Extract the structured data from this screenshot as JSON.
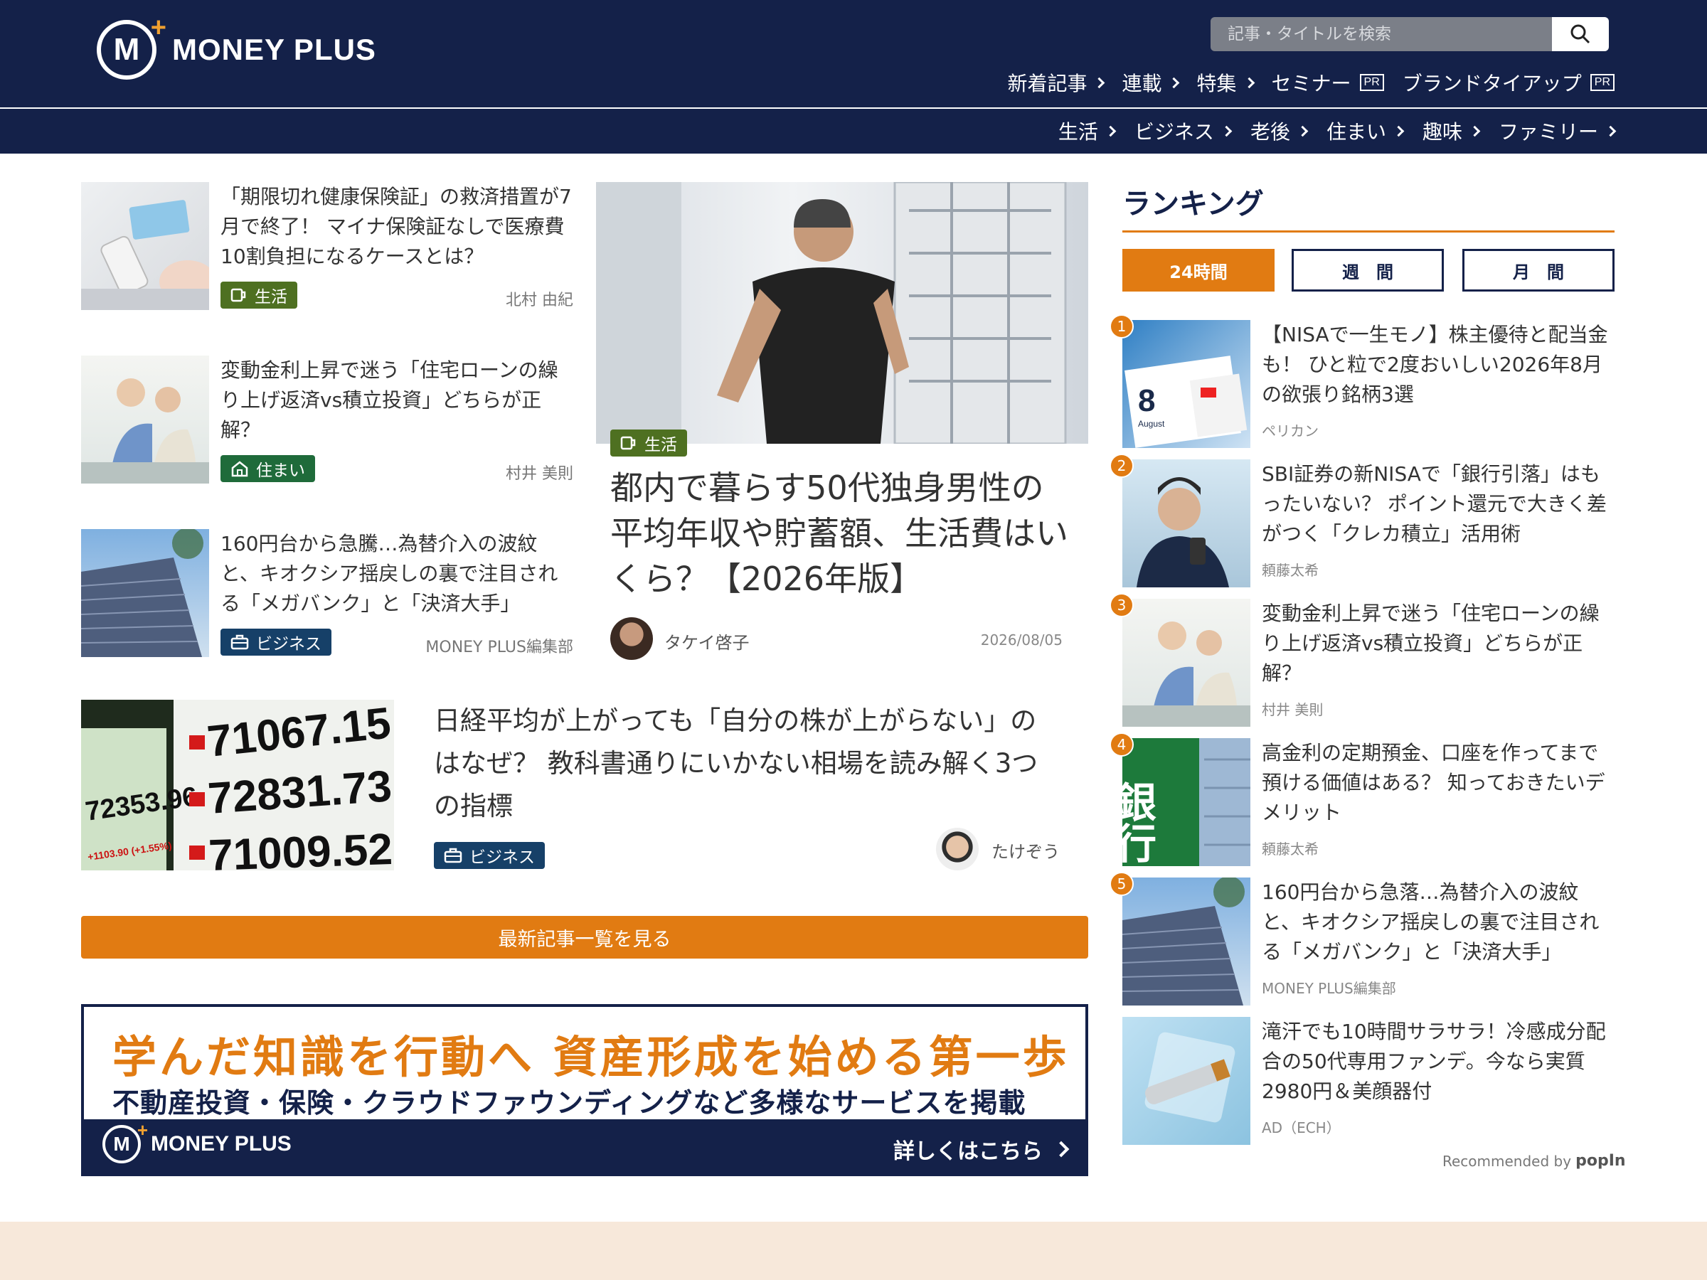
{
  "header": {
    "logo_text": "MONEY PLUS",
    "search_placeholder": "記事・タイトルを検索",
    "nav_main": [
      {
        "label": "新着記事",
        "pr": false
      },
      {
        "label": "連載",
        "pr": false
      },
      {
        "label": "特集",
        "pr": false
      },
      {
        "label": "セミナー",
        "pr": true
      },
      {
        "label": "ブランドタイアップ",
        "pr": true
      }
    ],
    "pr_label": "PR",
    "nav_categories": [
      "生活",
      "ビジネス",
      "老後",
      "住まい",
      "趣味",
      "ファミリー"
    ]
  },
  "articles": [
    {
      "title": "「期限切れ健康保険証」の救済措置が7月で終了！ マイナ保険証なしで医療費10割負担になるケースとは？",
      "tag": "生活",
      "author": "北村 由紀"
    },
    {
      "title": "変動金利上昇で迷う「住宅ローンの繰り上げ返済vs積立投資」どちらが正解？",
      "tag": "住まい",
      "author": "村井 美則"
    },
    {
      "title": "160円台から急騰…為替介入の波紋と、キオクシア揺戻しの裏で注目される「メガバンク」と「決済大手」",
      "tag": "ビジネス",
      "author": "MONEY PLUS編集部"
    }
  ],
  "feature": {
    "tag": "生活",
    "title": "都内で暮らす50代独身男性の平均年収や貯蓄額、生活費はいくら？【2026年版】",
    "author": "タケイ啓子",
    "date": "2026/08/05"
  },
  "wide_article": {
    "title": "日経平均が上がっても「自分の株が上がらない」のはなぜ？ 教科書通りにいかない相場を読み解く3つの指標",
    "tag": "ビジネス",
    "author": "たけぞう",
    "board_values": [
      "71067.15",
      "72831.73",
      "71009.52",
      "72353.96",
      "+1103.90 (+1.55%)"
    ]
  },
  "latest_button": "最新記事一覧を見る",
  "banner": {
    "headline": "学んだ知識を行動へ 資産形成を始める第一歩",
    "subline": "不動産投資・保険・クラウドファウンディングなど多様なサービスを掲載",
    "logo_text": "MONEY PLUS",
    "more": "詳しくはこちら"
  },
  "ranking": {
    "title": "ランキング",
    "tabs": [
      "24時間",
      "週　間",
      "月　間"
    ],
    "active_tab": 0,
    "items": [
      {
        "num": "1",
        "title": "【NISAで一生モノ】株主優待と配当金も！ ひと粒で2度おいしい2026年8月の欲張り銘柄3選",
        "author": "ペリカン"
      },
      {
        "num": "2",
        "title": "SBI証券の新NISAで「銀行引落」はもったいない？ ポイント還元で大きく差がつく「クレカ積立」活用術",
        "author": "頼藤太希"
      },
      {
        "num": "3",
        "title": "変動金利上昇で迷う「住宅ローンの繰り上げ返済vs積立投資」どちらが正解？",
        "author": "村井 美則"
      },
      {
        "num": "4",
        "title": "高金利の定期預金、口座を作ってまで預ける価値はある？ 知っておきたいデメリット",
        "author": "頼藤太希"
      },
      {
        "num": "5",
        "title": "160円台から急落…為替介入の波紋と、キオクシア揺戻しの裏で注目される「メガバンク」と「決済大手」",
        "author": "MONEY PLUS編集部"
      },
      {
        "num": "",
        "title": "滝汗でも10時間サラサラ！冷感成分配合の50代専用ファンデ。今なら実質2980円＆美顔器付",
        "author": "AD（ECH）"
      }
    ],
    "recommended": "Recommended by",
    "popin": "popIn"
  },
  "thumb_text": {
    "calendar_num": "8",
    "calendar_month": "August",
    "bank_sign": "銀行"
  }
}
